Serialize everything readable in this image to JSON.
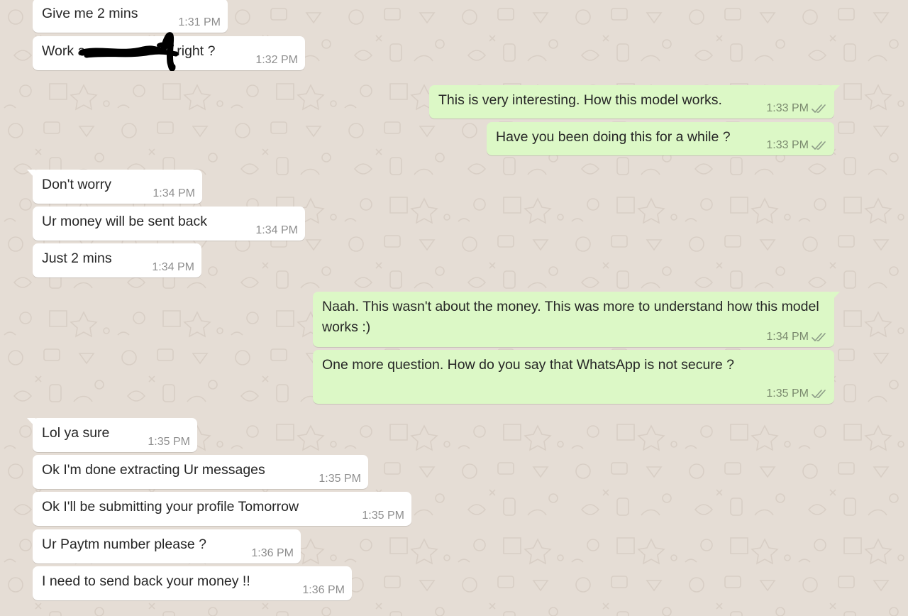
{
  "colors": {
    "background": "#e5ddd5",
    "incoming_bubble": "#ffffff",
    "outgoing_bubble": "#dcf8c6",
    "text": "#262626",
    "meta": "#8c8c8c"
  },
  "messages": [
    {
      "direction": "in",
      "text": "Give me 2 mins",
      "time": "1:31 PM"
    },
    {
      "direction": "in",
      "text": "Work a",
      "text_after": "right ?",
      "redacted": true,
      "time": "1:32 PM"
    },
    {
      "direction": "out",
      "text": "This is very interesting. How this model works.",
      "time": "1:33 PM",
      "status_icon": "double-check-icon"
    },
    {
      "direction": "out",
      "text": "Have you been doing this for a while ?",
      "time": "1:33 PM",
      "status_icon": "double-check-icon"
    },
    {
      "direction": "in",
      "text": "Don't worry",
      "time": "1:34 PM"
    },
    {
      "direction": "in",
      "text": "Ur money will be sent back",
      "time": "1:34 PM"
    },
    {
      "direction": "in",
      "text": "Just 2 mins",
      "time": "1:34 PM"
    },
    {
      "direction": "out",
      "text": "Naah. This wasn't about the money. This was more to understand how this model works :)",
      "time": "1:34 PM",
      "status_icon": "double-check-icon"
    },
    {
      "direction": "out",
      "text": "One more question. How do you say that WhatsApp is not secure ?",
      "time": "1:35 PM",
      "status_icon": "double-check-icon"
    },
    {
      "direction": "in",
      "text": "Lol ya sure",
      "time": "1:35 PM"
    },
    {
      "direction": "in",
      "text": "Ok I'm done extracting Ur messages",
      "time": "1:35 PM"
    },
    {
      "direction": "in",
      "text": "Ok I'll be submitting your profile Tomorrow",
      "time": "1:35 PM"
    },
    {
      "direction": "in",
      "text": "Ur Paytm number please ?",
      "time": "1:36 PM"
    },
    {
      "direction": "in",
      "text": "I need to send back your money !!",
      "time": "1:36 PM"
    }
  ]
}
